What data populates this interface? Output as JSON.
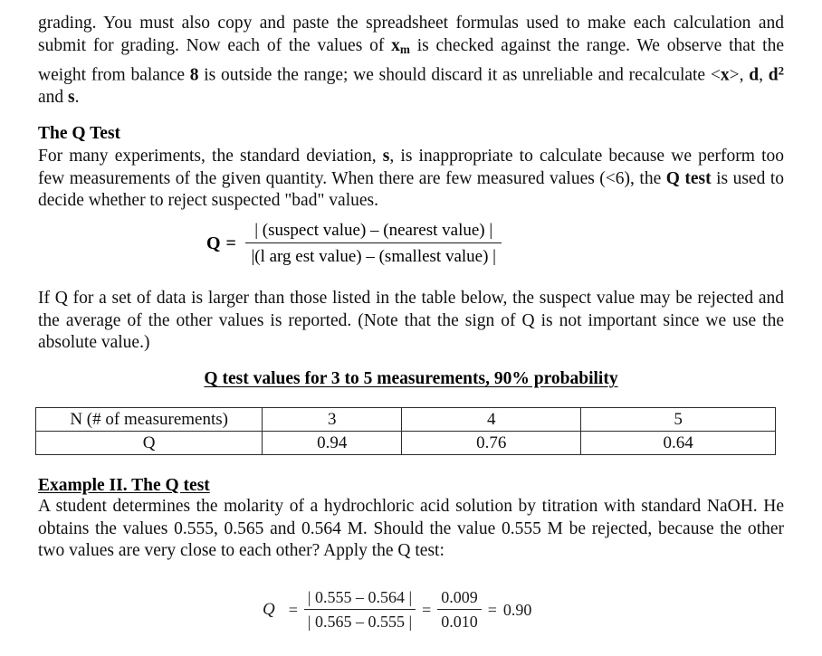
{
  "document": {
    "paragraph_1": {
      "line_1": "grading. You must also copy and paste the spreadsheet formulas used to make each calculation",
      "line_2_a": "and submit for grading.  Now each of the values of ",
      "line_2_sym": "x",
      "line_2_sub": "m",
      "line_2_b": " is checked against the range. We observe",
      "line_3_a": "that the weight from balance ",
      "line_3_bold": "8",
      "line_3_b": " is outside the range; we should discard it as unreliable and",
      "line_4_a": "recalculate <",
      "line_4_x": "x",
      "line_4_b": ">, ",
      "line_4_d1": "d",
      "line_4_c": ", ",
      "line_4_d2": "d",
      "line_4_sup": "2",
      "line_4_d": " and ",
      "line_4_s": "s",
      "line_4_e": "."
    },
    "qtest_heading": "The Q Test",
    "qtest_paragraph": {
      "part_1": "For many experiments, the standard deviation, ",
      "bold_s": "s",
      "part_2": ", is inappropriate to calculate because we perform too few measurements of the given quantity. When there are few measured values (<6), the ",
      "bold_qtest": "Q test",
      "part_3": " is used to decide whether to reject suspected \"bad\" values."
    },
    "q_formula": {
      "lhs": "Q =",
      "numerator": "| (suspect value) – (nearest  value) |",
      "denominator": "|(l arg est value) – (smallest value) |"
    },
    "if_q_paragraph": "If Q for a set of data is larger than those listed in the table below, the suspect value may be rejected and the average of the other values is reported. (Note that the sign of Q is not important since we use the absolute value.)",
    "table_caption": "Q test values for 3 to 5 measurements, 90% probability",
    "table": {
      "row_labels": [
        "N (# of measurements)",
        "Q"
      ],
      "columns": [
        {
          "n": "3",
          "q": "0.94"
        },
        {
          "n": "4",
          "q": "0.76"
        },
        {
          "n": "5",
          "q": "0.64"
        }
      ]
    },
    "example_heading": "Example II. The Q test",
    "example_paragraph": "A student determines the molarity of a hydrochloric acid solution by titration with standard NaOH. He obtains the values 0.555, 0.565 and 0.564 M. Should the value 0.555 M be rejected, because the other two values are very close to each other? Apply the Q test:",
    "worked_formula": {
      "lhs": "Q",
      "equals_1": "=",
      "numerator_1": "| 0.555 – 0.564 |",
      "denominator_1": "| 0.565 – 0.555 |",
      "equals_2": "=",
      "numerator_2": "0.009",
      "denominator_2": "0.010",
      "equals_3": "=",
      "result": "0.90"
    }
  },
  "chart_data": {
    "type": "table",
    "title": "Q test values for 3 to 5 measurements, 90% probability",
    "categories": [
      "3",
      "4",
      "5"
    ],
    "values": [
      0.94,
      0.76,
      0.64
    ],
    "xlabel": "N (# of measurements)",
    "ylabel": "Q"
  }
}
